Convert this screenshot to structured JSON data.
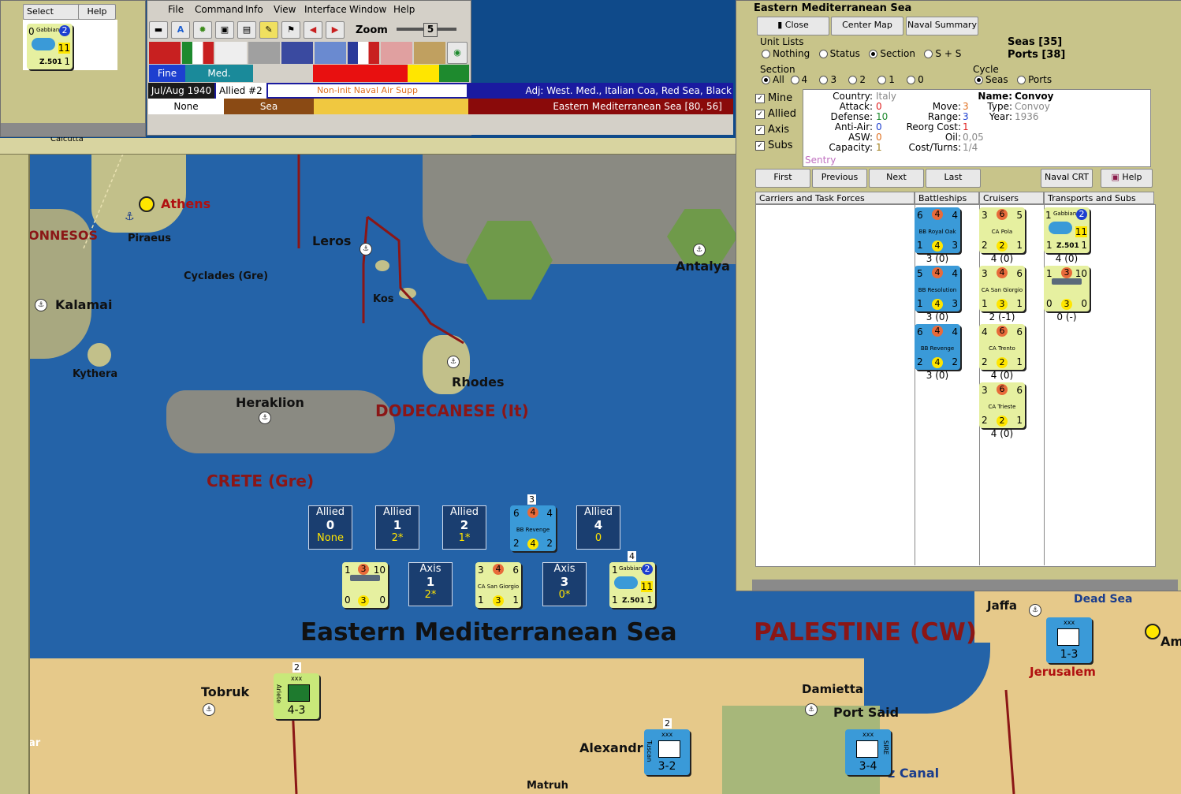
{
  "select_panel": {
    "select_label": "Select",
    "help_label": "Help",
    "counter": {
      "top_left": "0",
      "name": "Gabbiano",
      "badge": "2",
      "value": "11",
      "bottom": "1",
      "label": "Z.501"
    }
  },
  "menu": {
    "items": [
      "File",
      "Command",
      "Info",
      "View",
      "Interface",
      "Window",
      "Help"
    ]
  },
  "toolbar": {
    "zoom_label": "Zoom",
    "zoom_value": "5"
  },
  "info_bar": {
    "weather_fine": "Fine",
    "weather_med": "Med.",
    "date": "Jul/Aug 1940",
    "impulse": "Allied #2",
    "naval_air": "Non-init Naval Air Supp",
    "adjacent": "Adj: West. Med., Italian Coa, Red Sea, Black",
    "none_label": "None",
    "terrain": "Sea",
    "location": "Eastern Mediterranean Sea [80, 56]"
  },
  "calcutta_label": "Calcutta",
  "map": {
    "labels": {
      "athens": "Athens",
      "piraeus": "Piraeus",
      "peloponnesos": "ONNESOS",
      "kalamai": "Kalamai",
      "cyclades": "Cyclades (Gre)",
      "leros": "Leros",
      "kos": "Kos",
      "kythera": "Kythera",
      "rhodes": "Rhodes",
      "heraklion": "Heraklion",
      "dodecanese": "DODECANESE (It)",
      "crete": "CRETE (Gre)",
      "antalya": "Antalya",
      "sea_name": "Eastern Mediterranean Sea",
      "palestine": "PALESTINE (CW)",
      "jaffa": "Jaffa",
      "dead_sea": "Dead Sea",
      "jerusalem": "Jerusalem",
      "am": "Am",
      "tobruk": "Tobruk",
      "damietta": "Damietta",
      "port_said": "Port Said",
      "alexandria": "Alexandri",
      "suez": "z Canal",
      "matruh": "Matruh",
      "ar": "ar"
    },
    "allied_boxes": [
      {
        "title": "Allied",
        "num": "0",
        "val": "None"
      },
      {
        "title": "Allied",
        "num": "1",
        "val": "2*"
      },
      {
        "title": "Allied",
        "num": "2",
        "val": "1*"
      },
      {
        "title": "Allied",
        "num": "4",
        "val": "0"
      }
    ],
    "axis_boxes": [
      {
        "title": "Axis",
        "num": "1",
        "val": "2*"
      },
      {
        "title": "Axis",
        "num": "3",
        "val": "0*"
      }
    ],
    "sea_counters": {
      "bb_revenge": {
        "stack": "3",
        "a": "6",
        "b": "4",
        "c": "4",
        "name": "BB Revenge",
        "d": "2",
        "e": "4",
        "f": "2"
      },
      "convoy": {
        "a": "1",
        "b": "3",
        "c": "10",
        "d": "0",
        "e": "3",
        "f": "0"
      },
      "ca_sg": {
        "a": "3",
        "b": "4",
        "c": "6",
        "name": "CA San Giorgio",
        "d": "1",
        "e": "3",
        "f": "1"
      },
      "gabbiano": {
        "stack": "4",
        "a": "1",
        "name": "Gabbiano",
        "badge": "2",
        "val": "11",
        "d": "1",
        "label": "Z.501",
        "f": "1"
      }
    },
    "land_counters": {
      "tobruk": {
        "stack": "2",
        "corps": "xxx",
        "side": "Ariete",
        "str": "4-3"
      },
      "alex": {
        "stack": "2",
        "corps": "xxx",
        "side": "Tuscan",
        "str": "3-2"
      },
      "suez": {
        "corps": "xxx",
        "side": "SIRE",
        "str": "3-4"
      },
      "jerusalem": {
        "corps": "xxx",
        "str": "1-3"
      }
    }
  },
  "naval_window": {
    "title": "Eastern Mediterranean Sea",
    "close_label": "Close",
    "center_label": "Center Map",
    "summary_label": "Naval Summary",
    "unit_lists_label": "Unit Lists",
    "unit_lists_options": [
      "Nothing",
      "Status",
      "Section",
      "S + S"
    ],
    "seas_count": "Seas [35]",
    "ports_count": "Ports [38]",
    "section_label": "Section",
    "section_options": [
      "All",
      "4",
      "3",
      "2",
      "1",
      "0"
    ],
    "cycle_label": "Cycle",
    "cycle_options": [
      "Seas",
      "Ports"
    ],
    "filters": [
      "Mine",
      "Allied",
      "Axis",
      "Subs"
    ],
    "details": {
      "country_l": "Country:",
      "country_v": "Italy",
      "attack_l": "Attack:",
      "attack_v": "0",
      "defense_l": "Defense:",
      "defense_v": "10",
      "antiair_l": "Anti-Air:",
      "antiair_v": "0",
      "asw_l": "ASW:",
      "asw_v": "0",
      "capacity_l": "Capacity:",
      "capacity_v": "1",
      "sentry": "Sentry",
      "move_l": "Move:",
      "move_v": "3",
      "range_l": "Range:",
      "range_v": "3",
      "reorg_l": "Reorg Cost:",
      "reorg_v": "1",
      "oil_l": "Oil:",
      "oil_v": "0,05",
      "cost_l": "Cost/Turns:",
      "cost_v": "1/4",
      "name_l": "Name:",
      "name_v": "Convoy",
      "type_l": "Type:",
      "type_v": "Convoy",
      "year_l": "Year:",
      "year_v": "1936"
    },
    "nav_buttons": [
      "First",
      "Previous",
      "Next",
      "Last"
    ],
    "crt_label": "Naval CRT",
    "help_label": "Help",
    "columns": [
      "Carriers and Task Forces",
      "Battleships",
      "Cruisers",
      "Transports and Subs"
    ],
    "battleships": [
      {
        "a": "6",
        "b": "4",
        "c": "4",
        "name": "BB Royal Oak",
        "d": "1",
        "e": "4",
        "f": "3",
        "status": "3 (0)"
      },
      {
        "a": "5",
        "b": "4",
        "c": "4",
        "name": "BB Resolution",
        "d": "1",
        "e": "4",
        "f": "3",
        "status": "3 (0)"
      },
      {
        "a": "6",
        "b": "4",
        "c": "4",
        "name": "BB Revenge",
        "d": "2",
        "e": "4",
        "f": "2",
        "status": "3 (0)"
      }
    ],
    "cruisers": [
      {
        "a": "3",
        "b": "6",
        "c": "5",
        "name": "CA Pola",
        "d": "2",
        "e": "2",
        "f": "1",
        "status": "4 (0)"
      },
      {
        "a": "3",
        "b": "4",
        "c": "6",
        "name": "CA San Giorgio",
        "d": "1",
        "e": "3",
        "f": "1",
        "status": "2 (-1)"
      },
      {
        "a": "4",
        "b": "6",
        "c": "6",
        "name": "CA Trento",
        "d": "2",
        "e": "2",
        "f": "1",
        "status": "4 (0)"
      },
      {
        "a": "3",
        "b": "6",
        "c": "6",
        "name": "CA Trieste",
        "d": "2",
        "e": "2",
        "f": "1",
        "status": "4 (0)"
      }
    ],
    "transports": [
      {
        "a": "1",
        "name": "Gabbiano",
        "badge": "2",
        "val": "11",
        "d": "1",
        "label": "Z.501",
        "f": "1",
        "status": "4 (0)"
      },
      {
        "a": "1",
        "b": "3",
        "c": "10",
        "d": "0",
        "e": "3",
        "f": "0",
        "status": "0 (-)"
      }
    ]
  }
}
